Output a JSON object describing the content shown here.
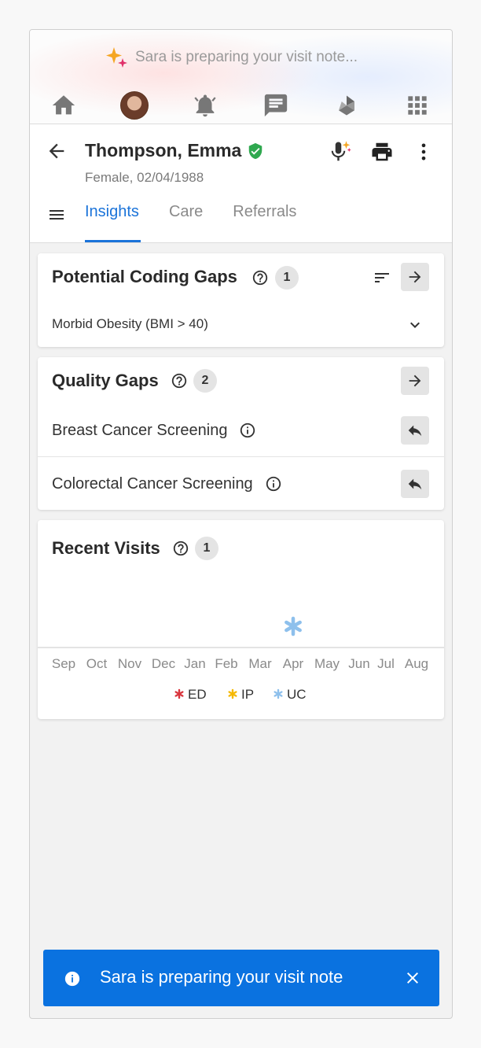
{
  "header": {
    "sara_message": "Sara is preparing your visit note...",
    "nav_icons": [
      "home-icon",
      "avatar",
      "bell-icon",
      "chat-icon",
      "apps-alt-icon",
      "grid-icon"
    ]
  },
  "patient": {
    "name": "Thompson, Emma",
    "meta": "Female, 02/04/1988",
    "verified_color": "#2fa84f"
  },
  "tabs": [
    {
      "label": "Insights",
      "active": true
    },
    {
      "label": "Care",
      "active": false
    },
    {
      "label": "Referrals",
      "active": false
    }
  ],
  "coding_gaps": {
    "title": "Potential Coding Gaps",
    "count": "1",
    "items": [
      {
        "label": "Morbid Obesity (BMI > 40)"
      }
    ]
  },
  "quality_gaps": {
    "title": "Quality Gaps",
    "count": "2",
    "items": [
      {
        "label": "Breast Cancer Screening"
      },
      {
        "label": "Colorectal Cancer Screening"
      }
    ]
  },
  "recent_visits": {
    "title": "Recent Visits",
    "count": "1"
  },
  "chart_data": {
    "type": "scatter",
    "title": "",
    "categories": [
      "Sep",
      "Oct",
      "Nov",
      "Dec",
      "Jan",
      "Feb",
      "Mar",
      "Apr",
      "May",
      "Jun",
      "Jul",
      "Aug"
    ],
    "series": [
      {
        "name": "ED",
        "color": "#d9363e",
        "points": []
      },
      {
        "name": "IP",
        "color": "#f5b800",
        "points": []
      },
      {
        "name": "UC",
        "color": "#8ec0ec",
        "points": [
          {
            "x": "Apr",
            "count": 1
          }
        ]
      }
    ],
    "legend": "bottom-center",
    "grid": false
  },
  "toast": {
    "message": "Sara is preparing your visit note",
    "bg_color": "#0a72e0"
  },
  "colors": {
    "accent": "#1a73d9"
  }
}
